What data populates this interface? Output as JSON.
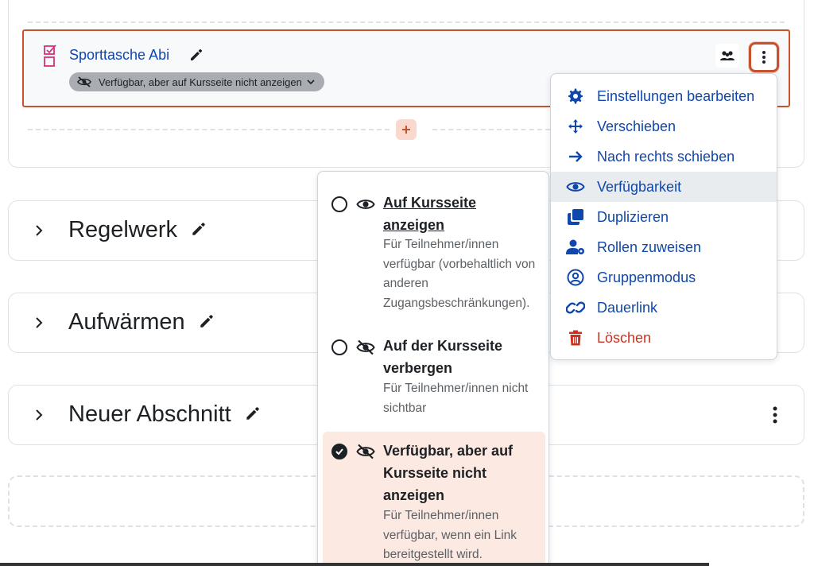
{
  "activity": {
    "title": "Sporttasche Abi",
    "availability_badge": "Verfügbar, aber auf Kursseite nicht anzeigen",
    "icons": [
      "assignment-icon",
      "edit-icon",
      "eye-slash-icon",
      "chevron-down-icon",
      "group-icon",
      "kebab-icon"
    ]
  },
  "sections": [
    {
      "title": "Regelwerk",
      "has_menu": false
    },
    {
      "title": "Aufwärmen",
      "has_menu": false
    },
    {
      "title": "Neuer Abschnitt",
      "has_menu": true
    }
  ],
  "visibility_options": [
    {
      "title": "Auf Kursseite anzeigen",
      "description": "Für Teilnehmer/innen verfügbar (vorbehaltlich von anderen Zugangsbeschränkungen).",
      "icon": "eye-icon",
      "selected": false
    },
    {
      "title": "Auf der Kursseite verbergen",
      "description": "Für Teilnehmer/innen nicht sichtbar",
      "icon": "eye-slash-icon",
      "selected": false
    },
    {
      "title": "Verfügbar, aber auf Kursseite nicht anzeigen",
      "description": "Für Teilnehmer/innen verfügbar, wenn ein Link bereitgestellt wird.",
      "icon": "eye-slash-icon",
      "selected": true
    }
  ],
  "action_menu": [
    {
      "label": "Einstellungen bearbeiten",
      "icon": "gear-icon"
    },
    {
      "label": "Verschieben",
      "icon": "move-arrows-icon"
    },
    {
      "label": "Nach rechts schieben",
      "icon": "arrow-right-icon"
    },
    {
      "label": "Verfügbarkeit",
      "icon": "eye-icon",
      "active": true
    },
    {
      "label": "Duplizieren",
      "icon": "copy-icon"
    },
    {
      "label": "Rollen zuweisen",
      "icon": "user-gear-icon"
    },
    {
      "label": "Gruppenmodus",
      "icon": "user-circle-icon"
    },
    {
      "label": "Dauerlink",
      "icon": "link-icon"
    },
    {
      "label": "Löschen",
      "icon": "trash-icon",
      "danger": true
    }
  ],
  "colors": {
    "accent": "#c9522e",
    "link": "#0f47ad",
    "danger": "#ca3120",
    "activity_icon": "#d8317c",
    "selected_bg": "#fbe9e2"
  }
}
